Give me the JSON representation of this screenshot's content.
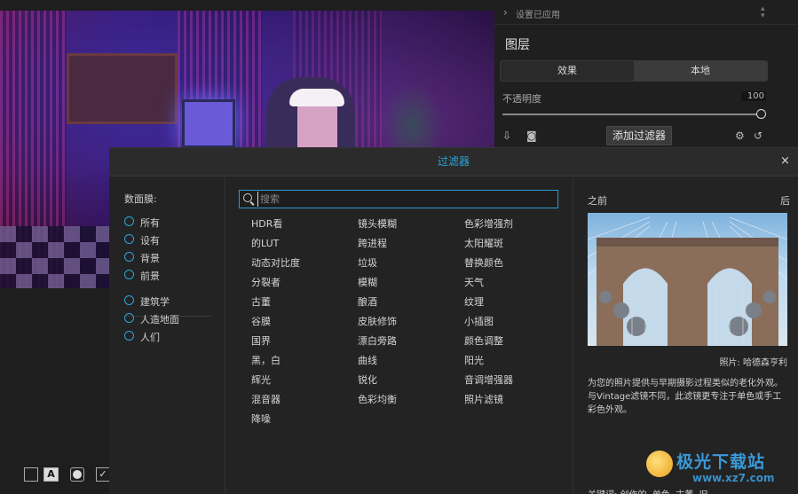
{
  "right_panel": {
    "applied_label": "设置已应用",
    "layers_title": "图层",
    "tabs": [
      "效果",
      "本地"
    ],
    "opacity_label": "不透明度",
    "opacity_value": "100",
    "add_filter_label": "添加过滤器"
  },
  "dialog": {
    "title": "过滤器",
    "close": "×",
    "sidebar": {
      "heading": "数面膜:",
      "categories_a": [
        "所有",
        "设有",
        "背景",
        "前景"
      ],
      "categories_b": [
        "建筑学",
        "人造地面",
        "人们"
      ]
    },
    "search": {
      "placeholder": "搜索"
    },
    "filters": {
      "col1": [
        "HDR看",
        "的LUT",
        "动态对比度",
        "分裂者",
        "古董",
        "谷膜",
        "国界",
        "黑，白",
        "辉光",
        "混音器",
        "降噪"
      ],
      "col2": [
        "镜头模糊",
        "跨进程",
        "垃圾",
        "模糊",
        "酿酒",
        "皮肤修饰",
        "漂白旁路",
        "曲线",
        "锐化",
        "色彩均衡"
      ],
      "col3": [
        "色彩增强剂",
        "太阳耀斑",
        "替换颜色",
        "天气",
        "纹理",
        "小插图",
        "颜色调整",
        "阳光",
        "音调增强器",
        "照片滤镜"
      ]
    },
    "preview": {
      "before_label": "之前",
      "after_label": "后",
      "credit": "照片: 哈德森亨利",
      "description": "为您的照片提供与早期摄影过程类似的老化外观。与Vintage滤镜不同，此滤镜更专注于单色或手工彩色外观。",
      "keywords": "关键词: 创作的, 单色, 古董, 旧"
    }
  },
  "watermark": {
    "text": "极光下载站",
    "url": "www.xz7.com"
  },
  "colors": {
    "accent": "#29a6d8",
    "bg": "#1b1b1b",
    "dialog_bg": "#232323"
  }
}
